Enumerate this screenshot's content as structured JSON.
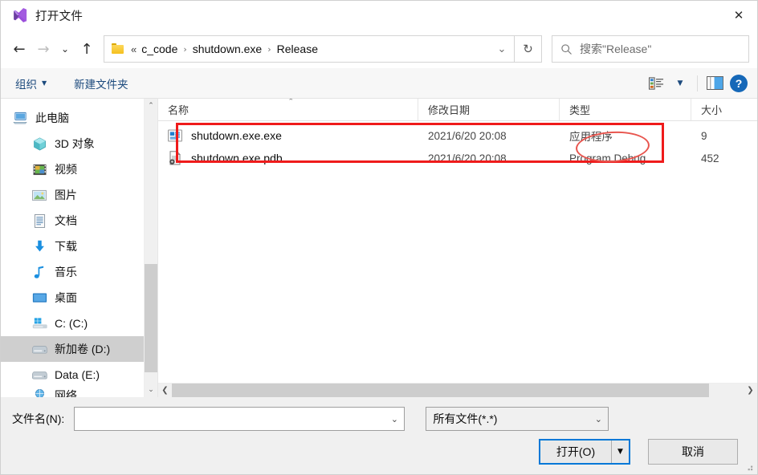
{
  "window": {
    "title": "打开文件",
    "app_icon": "visual-studio-icon",
    "close_label": "✕"
  },
  "nav": {
    "back": "←",
    "forward": "→",
    "recent": "⌄",
    "up": "↑",
    "address": {
      "folder_icon": "folder-icon",
      "ellipsis": "«",
      "crumbs": [
        "c_code",
        "shutdown.exe",
        "Release"
      ],
      "separator": "›",
      "dropdown": "⌄"
    },
    "refresh": "↻",
    "search": {
      "icon": "search-icon",
      "placeholder": "搜索\"Release\""
    }
  },
  "commandbar": {
    "organize_label": "组织",
    "organize_caret": "▼",
    "new_folder_label": "新建文件夹",
    "view_icon": "view-options-icon",
    "view_caret": "▼",
    "preview_icon": "preview-pane-icon",
    "help_icon": "help-icon",
    "help_glyph": "?"
  },
  "sidebar": {
    "items": [
      {
        "label": "此电脑",
        "icon": "this-pc-icon",
        "selected": false,
        "root": true
      },
      {
        "label": "3D 对象",
        "icon": "3d-objects-icon",
        "selected": false
      },
      {
        "label": "视频",
        "icon": "videos-icon",
        "selected": false
      },
      {
        "label": "图片",
        "icon": "pictures-icon",
        "selected": false
      },
      {
        "label": "文档",
        "icon": "documents-icon",
        "selected": false
      },
      {
        "label": "下载",
        "icon": "downloads-icon",
        "selected": false
      },
      {
        "label": "音乐",
        "icon": "music-icon",
        "selected": false
      },
      {
        "label": "桌面",
        "icon": "desktop-icon",
        "selected": false
      },
      {
        "label": "C: (C:)",
        "icon": "windows-drive-icon",
        "selected": false
      },
      {
        "label": "新加卷 (D:)",
        "icon": "drive-icon",
        "selected": true
      },
      {
        "label": "Data (E:)",
        "icon": "drive-icon",
        "selected": false
      },
      {
        "label": "网络",
        "icon": "network-icon",
        "selected": false,
        "clipped": true
      }
    ],
    "scroll_up": "⌃",
    "scroll_down": "⌄"
  },
  "filelist": {
    "columns": [
      "名称",
      "修改日期",
      "类型",
      "大小"
    ],
    "sort_caret": "⌃",
    "rows": [
      {
        "name": "shutdown.exe.exe",
        "icon": "application-exe-icon",
        "date": "2021/6/20 20:08",
        "type": "应用程序",
        "size": "9"
      },
      {
        "name": "shutdown.exe.pdb",
        "icon": "program-debug-database-icon",
        "date": "2021/6/20 20:08",
        "type": "Program Debug ...",
        "size": "452"
      }
    ],
    "hscroll_left": "❮",
    "hscroll_right": "❯"
  },
  "footer": {
    "filename_label": "文件名(N):",
    "filename_value": "",
    "filename_caret": "⌄",
    "filter_value": "所有文件(*.*)",
    "filter_caret": "⌄",
    "open_label": "打开(O)",
    "open_caret": "▼",
    "cancel_label": "取消"
  },
  "annotations": {
    "highlight_color": "#ef1b1b",
    "ellipse_color": "#e8554e",
    "rect_target": "shutdown.exe.exe-row",
    "ellipse_target": "应用程序"
  }
}
